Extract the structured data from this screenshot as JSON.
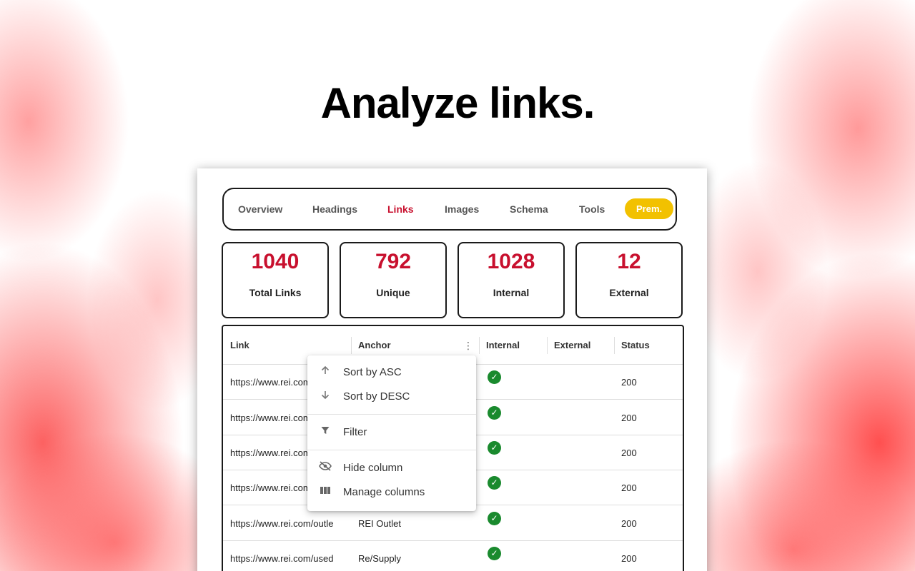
{
  "headline": "Analyze links.",
  "tabs": [
    {
      "label": "Overview",
      "active": false
    },
    {
      "label": "Headings",
      "active": false
    },
    {
      "label": "Links",
      "active": true
    },
    {
      "label": "Images",
      "active": false
    },
    {
      "label": "Schema",
      "active": false
    },
    {
      "label": "Tools",
      "active": false
    },
    {
      "label": "Prem.",
      "active": false
    }
  ],
  "stats": [
    {
      "value": "1040",
      "label": "Total Links"
    },
    {
      "value": "792",
      "label": "Unique"
    },
    {
      "value": "1028",
      "label": "Internal"
    },
    {
      "value": "12",
      "label": "External"
    }
  ],
  "table": {
    "columns": [
      "Link",
      "Anchor",
      "Internal",
      "External",
      "Status"
    ],
    "rows": [
      {
        "link": "https://www.rei.com",
        "anchor": "",
        "internal": true,
        "external": false,
        "status": "200"
      },
      {
        "link": "https://www.rei.com",
        "anchor": "",
        "internal": true,
        "external": false,
        "status": "200"
      },
      {
        "link": "https://www.rei.com",
        "anchor": "",
        "internal": true,
        "external": false,
        "status": "200"
      },
      {
        "link": "https://www.rei.com",
        "anchor": "",
        "internal": true,
        "external": false,
        "status": "200"
      },
      {
        "link": "https://www.rei.com/outle",
        "anchor": "REI Outlet",
        "internal": true,
        "external": false,
        "status": "200"
      },
      {
        "link": "https://www.rei.com/used",
        "anchor": "Re/Supply",
        "internal": true,
        "external": false,
        "status": "200"
      }
    ]
  },
  "column_menu": {
    "items": [
      {
        "label": "Sort by ASC",
        "icon": "arrow-up-icon"
      },
      {
        "label": "Sort by DESC",
        "icon": "arrow-down-icon"
      },
      {
        "label": "Filter",
        "icon": "filter-icon"
      },
      {
        "label": "Hide column",
        "icon": "eye-off-icon"
      },
      {
        "label": "Manage columns",
        "icon": "columns-icon"
      }
    ]
  },
  "colors": {
    "accent": "#c8102e",
    "premium": "#f2c100",
    "check": "#1a8a2e"
  }
}
